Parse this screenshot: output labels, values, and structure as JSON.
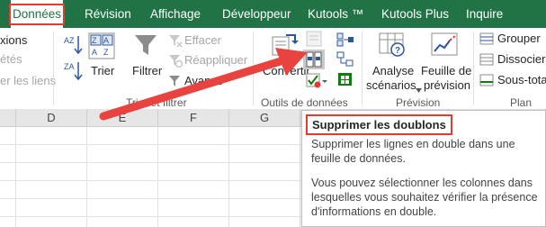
{
  "tabs": [
    {
      "label": "Données",
      "active": true
    },
    {
      "label": "Révision"
    },
    {
      "label": "Affichage"
    },
    {
      "label": "Développeur"
    },
    {
      "label": "Kutools ™"
    },
    {
      "label": "Kutools Plus"
    },
    {
      "label": "Inquire"
    }
  ],
  "ribbon": {
    "left_partial": [
      "xions",
      "étés",
      "er les liens"
    ],
    "sort": {
      "az": "AZ",
      "za": "ZA",
      "sort_label": "Trier"
    },
    "filter": {
      "label": "Filtrer",
      "clear": "Effacer",
      "reapply": "Réappliquer",
      "advanced": "Avancé"
    },
    "group_sort_filter": "Trier et filtrer",
    "data_tools": {
      "convert": "Convertir",
      "group": "Outils de données"
    },
    "forecast": {
      "whatif_line1": "Analyse",
      "whatif_line2": "scénarios",
      "sheet_line1": "Feuille de",
      "sheet_line2": "prévision",
      "group": "Prévision"
    },
    "outline": {
      "group_btn": "Grouper",
      "ungroup": "Dissocier",
      "subtotal": "Sous-total",
      "group": "Plan"
    }
  },
  "grid": {
    "columns": [
      "D",
      "E",
      "F",
      "G"
    ]
  },
  "tooltip": {
    "title": "Supprimer les doublons",
    "para1_line1": "Supprimer les lignes en double dans une",
    "para1_line2": "feuille de données.",
    "para2_line1": "Vous pouvez sélectionner les colonnes dans",
    "para2_line2": "lesquelles vous souhaitez vérifier la présence",
    "para2_line3": "d'informations en double."
  },
  "colors": {
    "excel_green": "#217346",
    "highlight_red": "#e03c31",
    "arrow_red": "#e8433f"
  }
}
